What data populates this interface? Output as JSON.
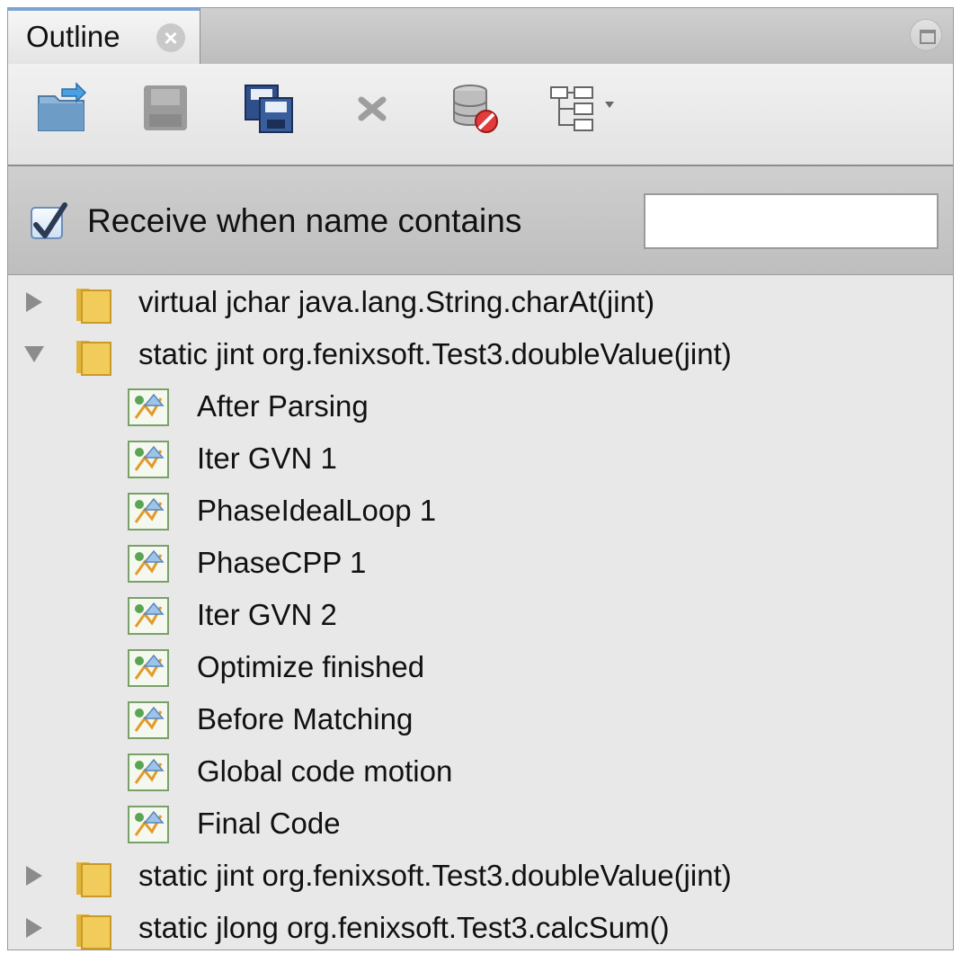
{
  "panel": {
    "tab_label": "Outline",
    "tab_close_icon": "close-icon",
    "maximize_icon": "maximize-icon"
  },
  "toolbar": {
    "buttons": [
      {
        "name": "import-icon"
      },
      {
        "name": "save-icon"
      },
      {
        "name": "save-all-icon"
      },
      {
        "name": "remove-icon"
      },
      {
        "name": "remove-database-icon"
      },
      {
        "name": "hierarchy-dropdown-icon"
      }
    ]
  },
  "filter": {
    "checked": true,
    "label": "Receive when name contains",
    "value": "",
    "placeholder": ""
  },
  "tree": {
    "groups": [
      {
        "label": "virtual jchar java.lang.String.charAt(jint)",
        "expanded": false
      },
      {
        "label": "static jint org.fenixsoft.Test3.doubleValue(jint)",
        "expanded": true,
        "children": [
          "After Parsing",
          "Iter GVN 1",
          "PhaseIdealLoop 1",
          "PhaseCPP 1",
          "Iter GVN 2",
          "Optimize finished",
          "Before Matching",
          "Global code motion",
          "Final Code"
        ]
      },
      {
        "label": "static jint org.fenixsoft.Test3.doubleValue(jint)",
        "expanded": false
      },
      {
        "label": "static jlong org.fenixsoft.Test3.calcSum()",
        "expanded": false
      }
    ]
  },
  "colors": {
    "folder": "#f2cc5a",
    "selection_check": "#2b3a55"
  }
}
